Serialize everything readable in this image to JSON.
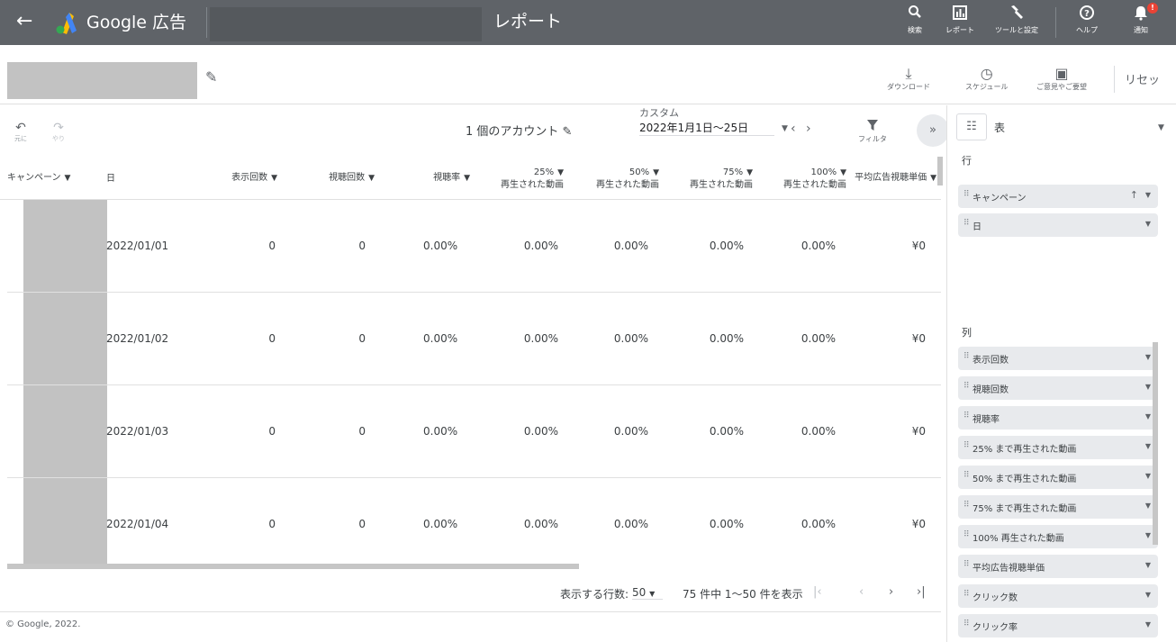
{
  "topbar": {
    "back_icon": "arrow-left-icon",
    "brand": "Google 広告",
    "title": "レポート",
    "items": [
      {
        "icon": "search-icon",
        "glyph": "⚲",
        "label": "検索"
      },
      {
        "icon": "report-icon",
        "glyph": "▥",
        "label": "レポート"
      },
      {
        "icon": "wrench-icon",
        "glyph": "🔧",
        "label": "ツールと設定"
      },
      {
        "icon": "help-icon",
        "glyph": "?",
        "label": "ヘルプ"
      },
      {
        "icon": "bell-icon",
        "glyph": "🔔",
        "label": "通知"
      }
    ],
    "notif_count": "!"
  },
  "header2": {
    "download": "ダウンロード",
    "schedule": "スケジュール",
    "feedback": "ご意見やご要望",
    "reset": "リセッ"
  },
  "toolbar": {
    "undo": "元に",
    "redo": "やり",
    "accounts": "1 個のアカウント",
    "date_caption": "カスタム",
    "date_value": "2022年1月1日〜25日",
    "filter": "フィルタ",
    "collapse": "»"
  },
  "table": {
    "headers": [
      {
        "l1": "キャンペーン",
        "l2": ""
      },
      {
        "l1": "日",
        "l2": ""
      },
      {
        "l1": "表示回数",
        "l2": ""
      },
      {
        "l1": "視聴回数",
        "l2": ""
      },
      {
        "l1": "視聴率",
        "l2": ""
      },
      {
        "l1": "25%",
        "l2": "再生された動画"
      },
      {
        "l1": "50%",
        "l2": "再生された動画"
      },
      {
        "l1": "75%",
        "l2": "再生された動画"
      },
      {
        "l1": "100%",
        "l2": "再生された動画"
      },
      {
        "l1": "平均広告視聴単価",
        "l2": ""
      }
    ],
    "rows": [
      {
        "date": "2022/01/01",
        "impr": "0",
        "views": "0",
        "rate": "0.00%",
        "p25": "0.00%",
        "p50": "0.00%",
        "p75": "0.00%",
        "p100": "0.00%",
        "cpv": "¥0"
      },
      {
        "date": "2022/01/02",
        "impr": "0",
        "views": "0",
        "rate": "0.00%",
        "p25": "0.00%",
        "p50": "0.00%",
        "p75": "0.00%",
        "p100": "0.00%",
        "cpv": "¥0"
      },
      {
        "date": "2022/01/03",
        "impr": "0",
        "views": "0",
        "rate": "0.00%",
        "p25": "0.00%",
        "p50": "0.00%",
        "p75": "0.00%",
        "p100": "0.00%",
        "cpv": "¥0"
      },
      {
        "date": "2022/01/04",
        "impr": "0",
        "views": "0",
        "rate": "0.00%",
        "p25": "0.00%",
        "p50": "0.00%",
        "p75": "0.00%",
        "p100": "0.00%",
        "cpv": "¥0"
      }
    ]
  },
  "pager": {
    "rows_label": "表示する行数:",
    "rows_value": "50",
    "range": "75 件中 1〜50 件を表示"
  },
  "footer": "© Google, 2022.",
  "panel": {
    "viz_label": "表",
    "rows_title": "行",
    "row_chips": [
      "キャンペーン",
      "日"
    ],
    "cols_title": "列",
    "col_chips": [
      "表示回数",
      "視聴回数",
      "視聴率",
      "25% まで再生された動画",
      "50% まで再生された動画",
      "75% まで再生された動画",
      "100% 再生された動画",
      "平均広告視聴単価",
      "クリック数",
      "クリック率"
    ]
  },
  "colors": {
    "topbar": "#5f6368",
    "accent_blue": "#4285f4",
    "accent_yellow": "#fbbc04",
    "accent_green": "#34a853",
    "alert_red": "#ea4335"
  }
}
